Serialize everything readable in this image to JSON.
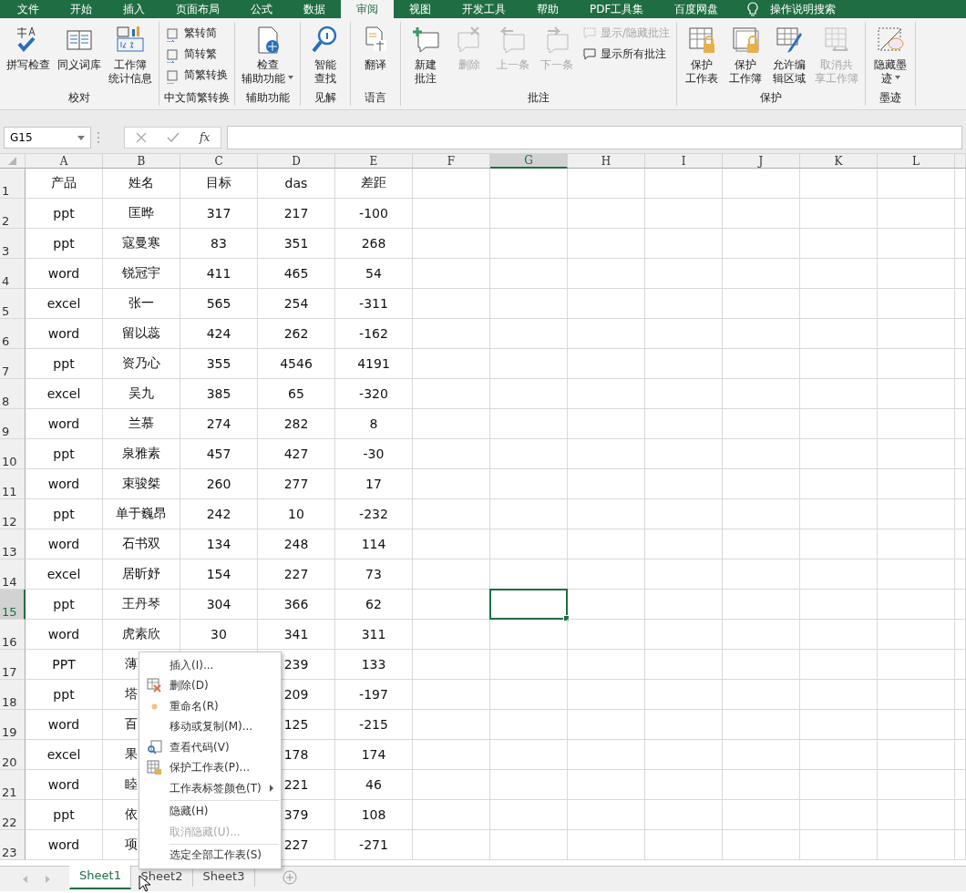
{
  "menu_tabs": [
    {
      "label": "文件",
      "selected": false
    },
    {
      "label": "开始",
      "selected": false
    },
    {
      "label": "插入",
      "selected": false
    },
    {
      "label": "页面布局",
      "selected": false
    },
    {
      "label": "公式",
      "selected": false
    },
    {
      "label": "数据",
      "selected": false
    },
    {
      "label": "审阅",
      "selected": true
    },
    {
      "label": "视图",
      "selected": false
    },
    {
      "label": "开发工具",
      "selected": false
    },
    {
      "label": "帮助",
      "selected": false
    },
    {
      "label": "PDF工具集",
      "selected": false
    },
    {
      "label": "百度网盘",
      "selected": false
    }
  ],
  "tell_me": {
    "placeholder": "操作说明搜索"
  },
  "ribbon_groups": [
    {
      "label": "校对",
      "buttons": [
        {
          "kind": "large",
          "label": "拼写检查",
          "disabled": false
        },
        {
          "kind": "large",
          "label": "同义词库",
          "disabled": false
        },
        {
          "kind": "large",
          "label": [
            "工作簿",
            "统计信息"
          ],
          "disabled": false
        }
      ]
    },
    {
      "label": "中文简繁转换",
      "buttons": [
        {
          "kind": "small",
          "label": "繁转简",
          "disabled": false
        },
        {
          "kind": "small",
          "label": "简转繁",
          "disabled": false
        },
        {
          "kind": "small",
          "label": "简繁转换",
          "disabled": false
        }
      ]
    },
    {
      "label": "辅助功能",
      "buttons": [
        {
          "kind": "large",
          "label": [
            "检查",
            "辅助功能"
          ],
          "disabled": false,
          "dropdown": true
        }
      ]
    },
    {
      "label": "见解",
      "buttons": [
        {
          "kind": "large",
          "label": [
            "智能",
            "查找"
          ],
          "disabled": false
        }
      ]
    },
    {
      "label": "语言",
      "buttons": [
        {
          "kind": "large",
          "label": "翻译",
          "disabled": false
        }
      ]
    },
    {
      "label": "批注",
      "buttons": [
        {
          "kind": "large",
          "label": [
            "新建",
            "批注"
          ],
          "disabled": false
        },
        {
          "kind": "large",
          "label": "删除",
          "disabled": true
        },
        {
          "kind": "large",
          "label": "上一条",
          "disabled": true
        },
        {
          "kind": "large",
          "label": "下一条",
          "disabled": true
        },
        {
          "kind": "small",
          "label": "显示/隐藏批注",
          "disabled": true
        },
        {
          "kind": "small",
          "label": "显示所有批注",
          "disabled": false
        }
      ]
    },
    {
      "label": "保护",
      "buttons": [
        {
          "kind": "large",
          "label": [
            "保护",
            "工作表"
          ],
          "disabled": false
        },
        {
          "kind": "large",
          "label": [
            "保护",
            "工作簿"
          ],
          "disabled": false
        },
        {
          "kind": "large",
          "label": [
            "允许编",
            "辑区域"
          ],
          "disabled": false
        },
        {
          "kind": "large",
          "label": [
            "取消共",
            "享工作簿"
          ],
          "disabled": true
        }
      ]
    },
    {
      "label": "墨迹",
      "buttons": [
        {
          "kind": "large",
          "label": [
            "隐藏墨",
            "迹"
          ],
          "disabled": false,
          "dropdown": true
        }
      ]
    }
  ],
  "formula_bar": {
    "name_box": "G15",
    "function_label": "fx"
  },
  "columns": [
    {
      "label": "A",
      "active": false
    },
    {
      "label": "B",
      "active": false
    },
    {
      "label": "C",
      "active": false
    },
    {
      "label": "D",
      "active": false
    },
    {
      "label": "E",
      "active": false
    },
    {
      "label": "F",
      "active": false
    },
    {
      "label": "G",
      "active": true
    },
    {
      "label": "H",
      "active": false
    },
    {
      "label": "I",
      "active": false
    },
    {
      "label": "J",
      "active": false
    },
    {
      "label": "K",
      "active": false
    },
    {
      "label": "L",
      "active": false
    }
  ],
  "rows": [
    {
      "num": "1",
      "active": false,
      "cells": [
        "产品",
        "姓名",
        "目标",
        "das",
        "差距"
      ]
    },
    {
      "num": "2",
      "active": false,
      "cells": [
        "ppt",
        "匡晔",
        "317",
        "217",
        "-100"
      ]
    },
    {
      "num": "3",
      "active": false,
      "cells": [
        "ppt",
        "寇曼寒",
        "83",
        "351",
        "268"
      ]
    },
    {
      "num": "4",
      "active": false,
      "cells": [
        "word",
        "锐冠宇",
        "411",
        "465",
        "54"
      ]
    },
    {
      "num": "5",
      "active": false,
      "cells": [
        "excel",
        "张一",
        "565",
        "254",
        "-311"
      ]
    },
    {
      "num": "6",
      "active": false,
      "cells": [
        "word",
        "留以蕊",
        "424",
        "262",
        "-162"
      ]
    },
    {
      "num": "7",
      "active": false,
      "cells": [
        "ppt",
        "资乃心",
        "355",
        "4546",
        "4191"
      ]
    },
    {
      "num": "8",
      "active": false,
      "cells": [
        "excel",
        "吴九",
        "385",
        "65",
        "-320"
      ]
    },
    {
      "num": "9",
      "active": false,
      "cells": [
        "word",
        "兰慕",
        "274",
        "282",
        "8"
      ]
    },
    {
      "num": "10",
      "active": false,
      "cells": [
        "ppt",
        "泉雅素",
        "457",
        "427",
        "-30"
      ]
    },
    {
      "num": "11",
      "active": false,
      "cells": [
        "word",
        "束骏桀",
        "260",
        "277",
        "17"
      ]
    },
    {
      "num": "12",
      "active": false,
      "cells": [
        "ppt",
        "单于巍昂",
        "242",
        "10",
        "-232"
      ]
    },
    {
      "num": "13",
      "active": false,
      "cells": [
        "word",
        "石书双",
        "134",
        "248",
        "114"
      ]
    },
    {
      "num": "14",
      "active": false,
      "cells": [
        "excel",
        "居昕妤",
        "154",
        "227",
        "73"
      ]
    },
    {
      "num": "15",
      "active": true,
      "cells": [
        "ppt",
        "王丹琴",
        "304",
        "366",
        "62"
      ]
    },
    {
      "num": "16",
      "active": false,
      "cells": [
        "word",
        "虎素欣",
        "30",
        "341",
        "311"
      ]
    },
    {
      "num": "17",
      "active": false,
      "cells": [
        "PPT",
        "薄",
        null,
        "239",
        "133"
      ]
    },
    {
      "num": "18",
      "active": false,
      "cells": [
        "ppt",
        "塔",
        null,
        "209",
        "-197"
      ]
    },
    {
      "num": "19",
      "active": false,
      "cells": [
        "word",
        "百",
        null,
        "125",
        "-215"
      ]
    },
    {
      "num": "20",
      "active": false,
      "cells": [
        "excel",
        "果",
        null,
        "178",
        "174"
      ]
    },
    {
      "num": "21",
      "active": false,
      "cells": [
        "word",
        "睦",
        null,
        "221",
        "46"
      ]
    },
    {
      "num": "22",
      "active": false,
      "cells": [
        "ppt",
        "依",
        null,
        "379",
        "108"
      ]
    },
    {
      "num": "23",
      "active": false,
      "cells": [
        "word",
        "项",
        null,
        "227",
        "-271"
      ]
    }
  ],
  "sheet_tabs": [
    {
      "label": "Sheet1",
      "selected": true
    },
    {
      "label": "Sheet2",
      "selected": false
    },
    {
      "label": "Sheet3",
      "selected": false
    }
  ],
  "context_menu": [
    {
      "kind": "item",
      "label": "插入(I)...",
      "disabled": false
    },
    {
      "kind": "item",
      "label": "删除(D)",
      "disabled": false
    },
    {
      "kind": "item",
      "label": "重命名(R)",
      "disabled": false
    },
    {
      "kind": "item",
      "label": "移动或复制(M)...",
      "disabled": false
    },
    {
      "kind": "item",
      "label": "查看代码(V)",
      "disabled": false
    },
    {
      "kind": "item",
      "label": "保护工作表(P)...",
      "disabled": false
    },
    {
      "kind": "submenu",
      "label": "工作表标签颜色(T)",
      "disabled": false
    },
    {
      "kind": "separator"
    },
    {
      "kind": "item",
      "label": "隐藏(H)",
      "disabled": false
    },
    {
      "kind": "item",
      "label": "取消隐藏(U)...",
      "disabled": true
    },
    {
      "kind": "separator"
    },
    {
      "kind": "item",
      "label": "选定全部工作表(S)",
      "disabled": false
    }
  ]
}
